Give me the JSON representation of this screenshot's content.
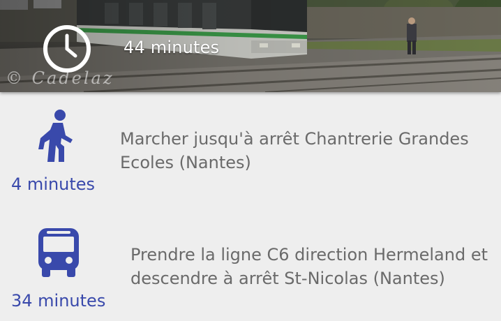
{
  "header": {
    "total_duration": "44 minutes",
    "watermark": "© Cadelaz",
    "icon": "clock-icon",
    "photo": "tram-photo"
  },
  "steps": [
    {
      "icon": "walk-icon",
      "duration": "4 minutes",
      "description": "Marcher jusqu'à arrêt Chantrerie Grandes Ecoles (Nantes)"
    },
    {
      "icon": "bus-icon",
      "duration": "34 minutes",
      "description": "Prendre la ligne C6 direction Hermeland et descendre à arrêt St-Nicolas (Nantes)"
    }
  ],
  "colors": {
    "accent": "#3949ab",
    "background": "#eeeeee",
    "description_text": "#6a6a6a",
    "header_text": "#ffffff"
  }
}
